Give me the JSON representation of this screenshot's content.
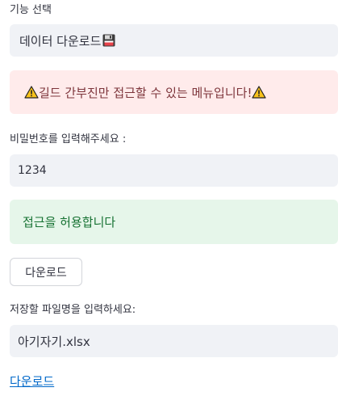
{
  "feature_select": {
    "label": "기능 선택",
    "selected_value": "데이터 다운로드",
    "icon": "floppy-disk-icon"
  },
  "warning": {
    "text": "길드 간부진만 접근할 수 있는 메뉴입니다!",
    "icon": "warning-icon",
    "color": "#7d353b",
    "background": "#ffebeb"
  },
  "password": {
    "label": "비밀번호를 입력해주세요 :",
    "value": "1234"
  },
  "success": {
    "text": "접근을 허용합니다",
    "color": "#177233",
    "background": "#e6f6ea"
  },
  "download_button": {
    "label": "다운로드"
  },
  "filename": {
    "label": "저장할 파일명을 입력하세요:",
    "value": "아기자기.xlsx"
  },
  "download_link": {
    "label": "다운로드",
    "color": "#0068c9"
  }
}
